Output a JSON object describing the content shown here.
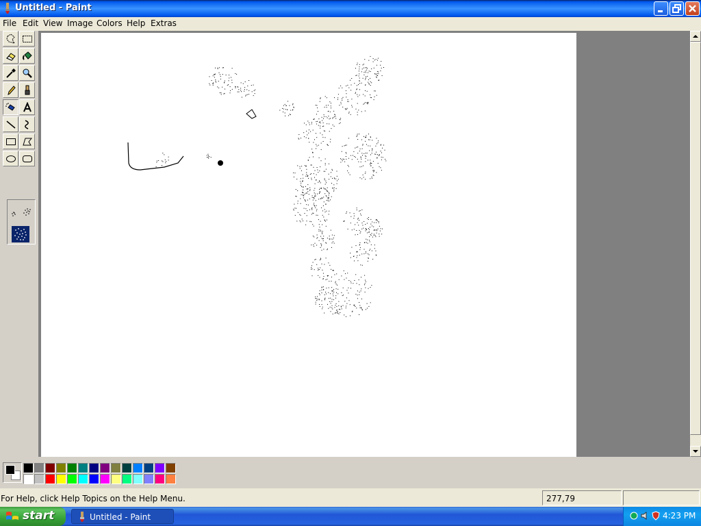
{
  "window": {
    "title": "Untitled - Paint"
  },
  "menu": {
    "items": [
      "File",
      "Edit",
      "View",
      "Image",
      "Colors",
      "Help",
      "Extras"
    ]
  },
  "tools": [
    {
      "name": "free-form-select-icon"
    },
    {
      "name": "select-icon"
    },
    {
      "name": "eraser-icon"
    },
    {
      "name": "fill-with-color-icon"
    },
    {
      "name": "pick-color-icon"
    },
    {
      "name": "magnifier-icon"
    },
    {
      "name": "pencil-icon"
    },
    {
      "name": "brush-icon"
    },
    {
      "name": "airbrush-icon",
      "active": true
    },
    {
      "name": "text-icon"
    },
    {
      "name": "line-icon"
    },
    {
      "name": "curve-icon"
    },
    {
      "name": "rectangle-icon"
    },
    {
      "name": "polygon-icon"
    },
    {
      "name": "ellipse-icon"
    },
    {
      "name": "rounded-rectangle-icon"
    }
  ],
  "colors": {
    "foreground": "#000000",
    "background": "#ffffff",
    "palette_top": [
      "#000000",
      "#808080",
      "#800000",
      "#808000",
      "#008000",
      "#008080",
      "#000080",
      "#800080",
      "#808040",
      "#004040",
      "#0080ff",
      "#004080",
      "#8000ff",
      "#804000"
    ],
    "palette_bottom": [
      "#ffffff",
      "#c0c0c0",
      "#ff0000",
      "#ffff00",
      "#00ff00",
      "#00ffff",
      "#0000ff",
      "#ff00ff",
      "#ffff80",
      "#00ff80",
      "#80ffff",
      "#8080ff",
      "#ff0080",
      "#ff8040"
    ]
  },
  "status": {
    "help_text": "For Help, click Help Topics on the Help Menu.",
    "coordinates": "277,79"
  },
  "taskbar": {
    "start_label": "start",
    "task_label": "Untitled - Paint",
    "clock": "4:23 PM"
  }
}
